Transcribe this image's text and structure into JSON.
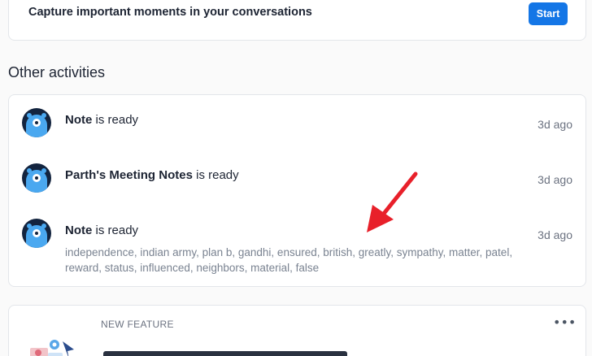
{
  "capture": {
    "text": "Capture important moments in your conversations",
    "start_label": "Start"
  },
  "section": {
    "heading": "Other activities"
  },
  "activities": [
    {
      "name": "Note",
      "suffix": " is ready",
      "time": "3d ago",
      "keywords": ""
    },
    {
      "name": "Parth's Meeting Notes",
      "suffix": " is ready",
      "time": "3d ago",
      "keywords": ""
    },
    {
      "name": "Note",
      "suffix": " is ready",
      "time": "3d ago",
      "keywords": "independence, indian army, plan b, gandhi, ensured, british, greatly, sympathy, matter, patel, reward, status, influenced, neighbors, material, false"
    }
  ],
  "feature": {
    "label": "NEW FEATURE",
    "more_icon": "more-horizontal-icon"
  },
  "colors": {
    "accent": "#1476e6",
    "annotation_arrow": "#e8202a",
    "avatar_bg": "#13243f",
    "avatar_body": "#4aa8f0"
  }
}
